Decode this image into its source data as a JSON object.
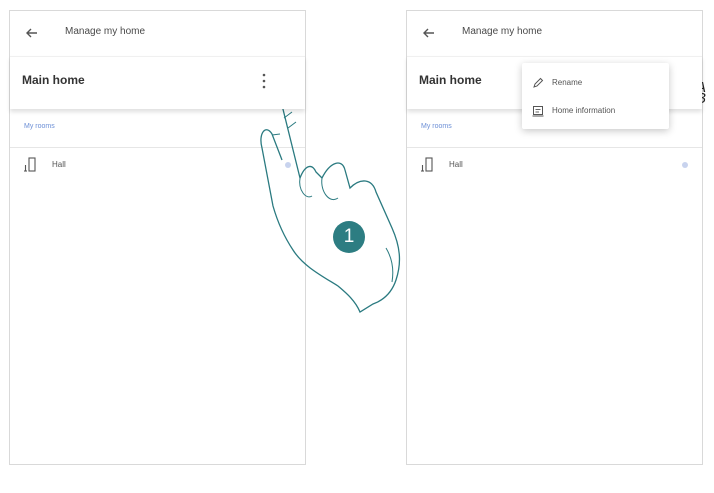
{
  "screen_left": {
    "header": {
      "title": "Manage my home",
      "back_icon": "back-arrow-icon"
    },
    "home_card": {
      "name": "Main home",
      "menu_icon": "kebab-menu-icon"
    },
    "section_link": "My rooms",
    "rooms": [
      {
        "label": "Hall",
        "icon": "room-door-icon"
      }
    ]
  },
  "screen_right": {
    "header": {
      "title": "Manage my home",
      "back_icon": "back-arrow-icon"
    },
    "home_card": {
      "name": "Main home"
    },
    "section_link": "My rooms",
    "rooms": [
      {
        "label": "Hall",
        "icon": "room-door-icon"
      }
    ],
    "menu": [
      {
        "label": "Rename",
        "icon": "pencil-icon"
      },
      {
        "label": "Home information",
        "icon": "info-card-icon"
      }
    ]
  },
  "step": {
    "number": "1"
  },
  "callouts": [
    {
      "letter": "A"
    },
    {
      "letter": "B"
    }
  ],
  "colors": {
    "accent": "#2d7d82",
    "link": "#6c8fd6",
    "line": "#2a7a80"
  }
}
